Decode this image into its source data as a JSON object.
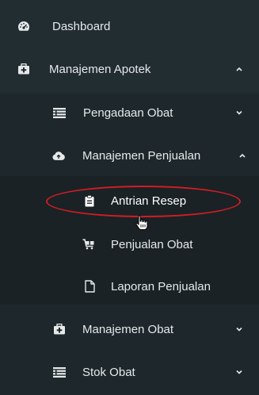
{
  "menu": {
    "dashboard": {
      "label": "Dashboard",
      "icon": "dashboard-icon"
    },
    "manajemen_apotek": {
      "label": "Manajemen Apotek",
      "icon": "medkit-icon",
      "state": "expanded"
    },
    "pengadaan_obat": {
      "label": "Pengadaan Obat",
      "icon": "list-icon",
      "state": "collapsed"
    },
    "manajemen_penjualan": {
      "label": "Manajemen Penjualan",
      "icon": "cloud-upload-icon",
      "state": "expanded"
    },
    "antrian_resep": {
      "label": "Antrian Resep",
      "icon": "clipboard-icon",
      "state": "hovered"
    },
    "penjualan_obat": {
      "label": "Penjualan Obat",
      "icon": "cart-icon"
    },
    "laporan_penjualan": {
      "label": "Laporan Penjualan",
      "icon": "file-icon"
    },
    "manajemen_obat": {
      "label": "Manajemen Obat",
      "icon": "medkit-icon",
      "state": "collapsed"
    },
    "stok_obat": {
      "label": "Stok Obat",
      "icon": "list-icon",
      "state": "collapsed"
    }
  },
  "colors": {
    "background": "#222d32",
    "submenu_background": "#1e282c",
    "nested_background": "#1a2226",
    "text": "#e6e9ea",
    "annotation": "#d21d23"
  }
}
